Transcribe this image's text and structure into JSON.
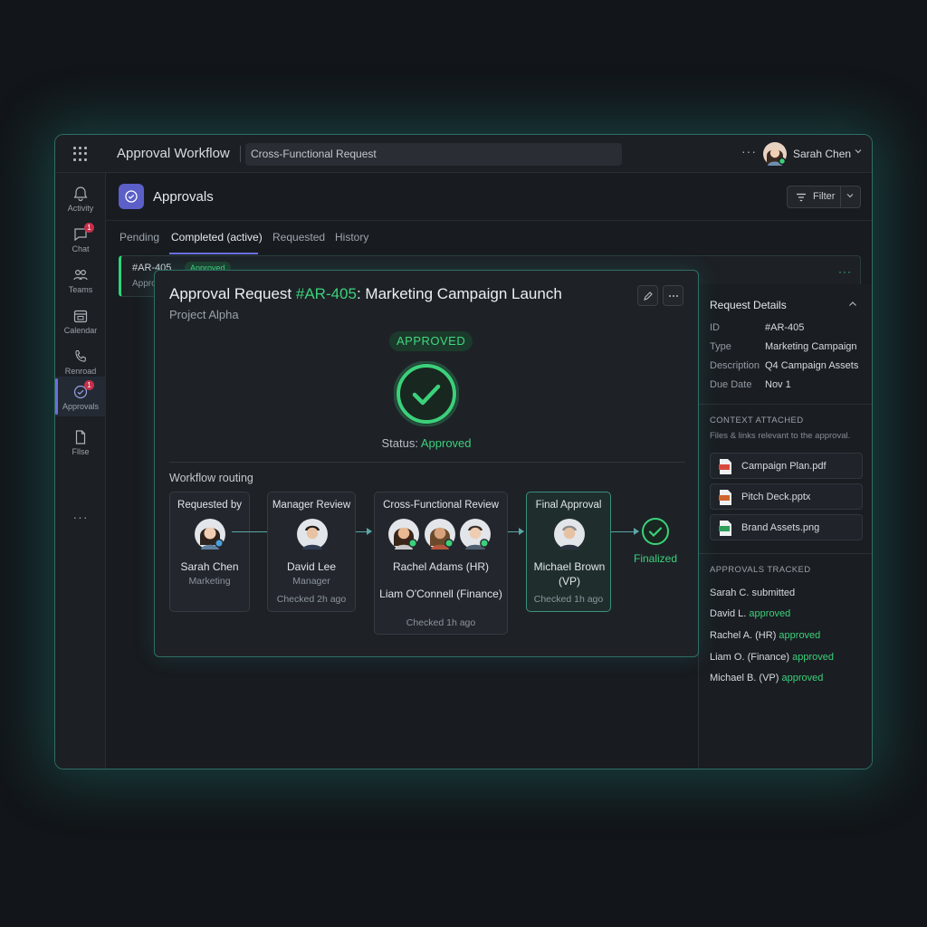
{
  "topbar": {
    "title": "Approval Workflow",
    "search_value": "Cross-Functional Request",
    "more": "···",
    "user_name": "Sarah Chen"
  },
  "rail": {
    "items": [
      {
        "label": "Activity",
        "icon": "bell-icon",
        "badge": ""
      },
      {
        "label": "Chat",
        "icon": "chat-icon",
        "badge": "1"
      },
      {
        "label": "Teams",
        "icon": "teams-icon",
        "badge": ""
      },
      {
        "label": "Calendar",
        "icon": "calendar-icon",
        "badge": ""
      },
      {
        "label": "Renroad",
        "icon": "phone-icon",
        "badge": ""
      },
      {
        "label": "Approvals",
        "icon": "approvals-icon",
        "badge": "1"
      },
      {
        "label": "Fllse",
        "icon": "file-icon",
        "badge": ""
      }
    ],
    "more": "···"
  },
  "header": {
    "title": "Approvals",
    "filter_label": "Filter"
  },
  "tabs": [
    {
      "label": "Pending"
    },
    {
      "label": "Completed (active)"
    },
    {
      "label": "Requested"
    },
    {
      "label": "History"
    }
  ],
  "list_row": {
    "id": "#AR-405",
    "badge": "Approved",
    "sub": "Appro",
    "more": "···"
  },
  "card": {
    "title_prefix": "Approval Request ",
    "title_id": "#AR-405",
    "title_suffix": ": Marketing Campaign Launch",
    "subtitle": "Project Alpha",
    "badge": "APPROVED",
    "status_label": "Status: ",
    "status_value": "Approved",
    "workflow_label": "Workflow routing",
    "steps": [
      {
        "header": "Requested by",
        "name": "Sarah Chen",
        "role": "Marketing"
      },
      {
        "header": "Manager Review",
        "name": "David Lee",
        "role": "Manager",
        "checked": "Checked 2h ago"
      },
      {
        "header": "Cross-Functional Review",
        "name1": "Rachel Adams (HR)",
        "name2": "Liam O'Connell (Finance)",
        "checked": "Checked 1h ago"
      },
      {
        "header": "Final Approval",
        "name": "Michael Brown (VP)",
        "checked": "Checked 1h ago"
      }
    ],
    "finalized": "Finalized"
  },
  "details": {
    "title": "Request Details",
    "rows": [
      {
        "key": "ID",
        "value": "#AR-405"
      },
      {
        "key": "Type",
        "value": "Marketing Campaign"
      },
      {
        "key": "Description",
        "value": "Q4 Campaign Assets"
      },
      {
        "key": "Due Date",
        "value": "Nov 1"
      }
    ],
    "context_caption": "CONTEXT ATTACHED",
    "context_note": "Files & links relevant to the approval.",
    "files": [
      {
        "name": "Campaign Plan.pdf",
        "icon": "pdf-icon",
        "color": "#d9483b"
      },
      {
        "name": "Pitch Deck.pptx",
        "icon": "pptx-icon",
        "color": "#d0642c"
      },
      {
        "name": "Brand Assets.png",
        "icon": "png-icon",
        "color": "#2e9e5b"
      }
    ],
    "tracked_caption": "APPROVALS TRACKED",
    "tracked": [
      {
        "who": "Sarah C. ",
        "what": "submitted",
        "approved": false
      },
      {
        "who": "David L. ",
        "what": "approved",
        "approved": true
      },
      {
        "who": "Rachel A. (HR) ",
        "what": "approved",
        "approved": true
      },
      {
        "who": "Liam O. (Finance) ",
        "what": "approved",
        "approved": true
      },
      {
        "who": "Michael B. (VP) ",
        "what": "approved",
        "approved": true
      }
    ]
  },
  "colors": {
    "accent": "#5b5fc7",
    "success": "#3bd17a",
    "teal_border": "#2f6e64",
    "background": "#121519"
  }
}
